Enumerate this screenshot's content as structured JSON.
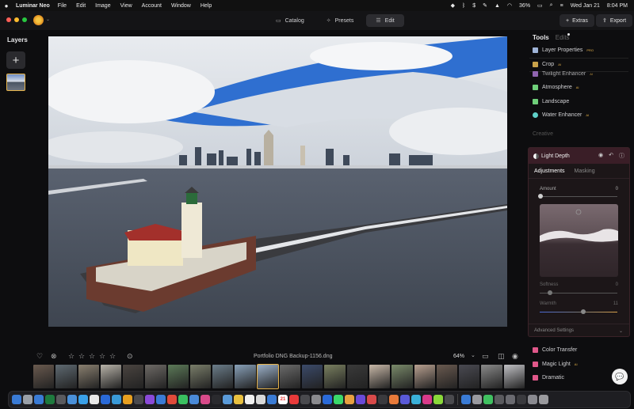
{
  "menubar": {
    "app_name": "Luminar Neo",
    "menus": [
      "File",
      "Edit",
      "Image",
      "View",
      "Account",
      "Window",
      "Help"
    ],
    "battery": "36%",
    "date": "Wed Jan 21",
    "time": "8:04 PM"
  },
  "topbar": {
    "modes": [
      {
        "label": "Catalog",
        "icon": "folder-icon"
      },
      {
        "label": "Presets",
        "icon": "presets-icon"
      },
      {
        "label": "Edit",
        "icon": "sliders-icon"
      }
    ],
    "active_mode": "Edit",
    "extras_label": "Extras",
    "export_label": "Export"
  },
  "layers": {
    "title": "Layers",
    "add_label": "+"
  },
  "right_panel": {
    "tabs": [
      "Tools",
      "Edits"
    ],
    "tools_top": [
      {
        "label": "Layer Properties",
        "badge": "PRO",
        "color": "#9fb4d8"
      },
      {
        "label": "Crop",
        "badge": "AI",
        "color": "#c9a24a"
      },
      {
        "label": "Twilight Enhancer",
        "badge": "AI",
        "color": "#b07ad8"
      },
      {
        "label": "Atmosphere",
        "badge": "AI",
        "color": "#6fcf7a"
      },
      {
        "label": "Landscape",
        "badge": "",
        "color": "#6fcf7a"
      },
      {
        "label": "Water Enhancer",
        "badge": "AI",
        "color": "#5fd0c8"
      }
    ],
    "section_creative": "Creative",
    "light_depth": {
      "title": "Light Depth",
      "subtabs": [
        "Adjustments",
        "Masking"
      ],
      "amount_label": "Amount",
      "amount_value": "0",
      "softness_label": "Softness",
      "softness_value": "0",
      "warmth_label": "Warmth",
      "warmth_value": "11",
      "advanced_label": "Advanced Settings"
    },
    "tools_bottom": [
      {
        "label": "Color Transfer",
        "badge": "",
        "color": "#e0588a"
      },
      {
        "label": "Magic Light",
        "badge": "AI",
        "color": "#e0588a"
      },
      {
        "label": "Dramatic",
        "badge": "",
        "color": "#e0588a"
      }
    ]
  },
  "bottom_bar": {
    "filename": "Portfolio DNG Backup-1156.dng",
    "zoom": "64%",
    "rating_stars": 5
  },
  "filmstrip": {
    "colors": [
      "#6a5a4f",
      "#5f6a72",
      "#8a8070",
      "#b7b2a8",
      "#4a4440",
      "#6e6a66",
      "#5c7a58",
      "#7a7e6a",
      "#6b7d8a",
      "#88a0b8",
      "#9bb0c8",
      "#6b6b6b",
      "#3b4a6a",
      "#7a8060",
      "#3a3a3a",
      "#c8b8a8",
      "#7a8a6a",
      "#b8a090",
      "#6a5a50",
      "#4a4a52",
      "#8a8a8a",
      "#c0c0c4"
    ],
    "selected_index": 10
  },
  "dock": {
    "calendar_day": "21",
    "app_colors": [
      "#3a7bd5",
      "#9aa0a8",
      "#3a7bd5",
      "#1e7a3e",
      "#5a5a5e",
      "#4a90d9",
      "#3aa0e8",
      "#e8e8e8",
      "#2a6ad8",
      "#3a9ad8",
      "#e8a020",
      "#4a4a4e",
      "#8a4ad8",
      "#3a7bd5",
      "#e04a3a",
      "#3ac060",
      "#4a8ad8",
      "#d84a8a",
      "#2a2a2e",
      "#5a9ad8",
      "#e8c040",
      "#f0f0f0",
      "#d8d8d8",
      "#3a7bd5",
      "#5ac05a",
      "#e83a3a",
      "#4a4a4e",
      "#8a8a8e",
      "#2a6ad8",
      "#3ad86a",
      "#e8a040",
      "#6a4ad8",
      "#d84a4a",
      "#3a3a3e",
      "#e87a3a",
      "#5a5ad8",
      "#3ab0d8",
      "#d83a8a",
      "#8ad83a",
      "#4a4a4e",
      "#3a7bd5",
      "#9a9aa0",
      "#40c060",
      "#5a5a5e",
      "#6a6a70",
      "#3a3a3e",
      "#8a8a90",
      "#9a9a9e"
    ]
  }
}
